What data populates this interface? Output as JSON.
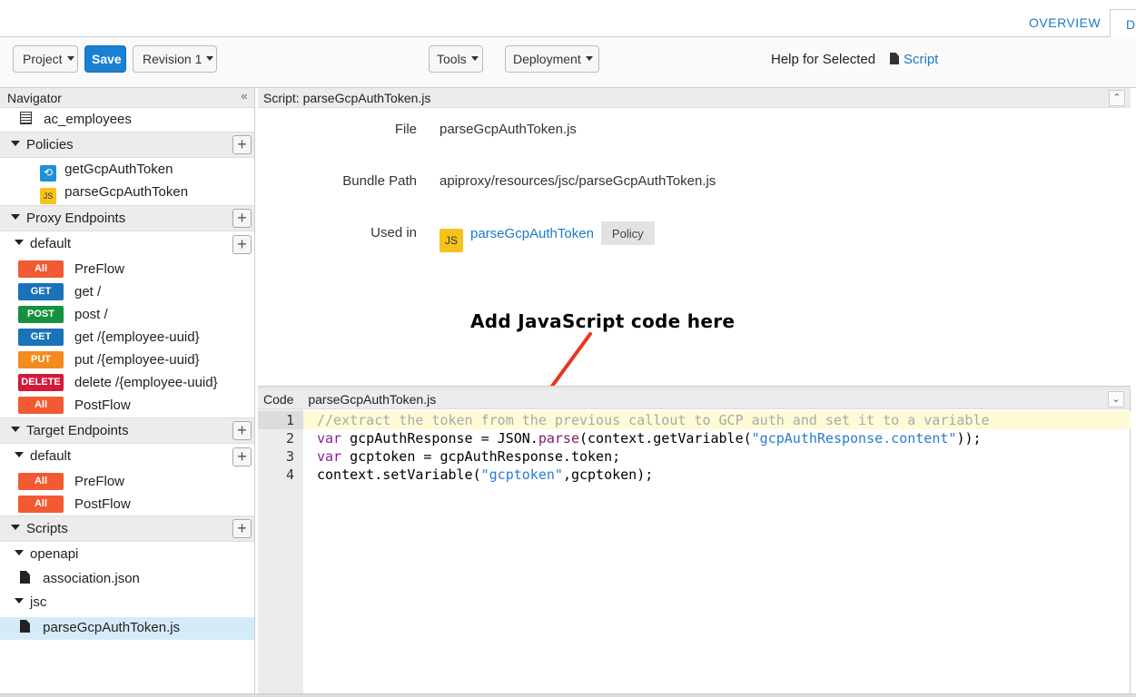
{
  "tabs": {
    "overview": "OVERVIEW",
    "develop": "D"
  },
  "toolbar": {
    "project": "Project",
    "save": "Save",
    "revision": "Revision 1",
    "tools": "Tools",
    "deployment": "Deployment",
    "help_label": "Help for Selected",
    "help_link": "Script"
  },
  "navigator": {
    "title": "Navigator",
    "collapse": "«",
    "top_item": "ac_employees",
    "policies": {
      "label": "Policies",
      "items": [
        {
          "icon": "callout-icon",
          "label": "getGcpAuthToken"
        },
        {
          "icon": "js-icon",
          "label": "parseGcpAuthToken"
        }
      ]
    },
    "proxy_endpoints": {
      "label": "Proxy Endpoints",
      "default_label": "default",
      "flows": [
        {
          "badge": "All",
          "label": "PreFlow"
        },
        {
          "badge": "GET",
          "label": "get /"
        },
        {
          "badge": "POST",
          "label": "post /"
        },
        {
          "badge": "GET",
          "label": "get /{employee-uuid}"
        },
        {
          "badge": "PUT",
          "label": "put /{employee-uuid}"
        },
        {
          "badge": "DELETE",
          "label": "delete /{employee-uuid}"
        },
        {
          "badge": "All",
          "label": "PostFlow"
        }
      ]
    },
    "target_endpoints": {
      "label": "Target Endpoints",
      "default_label": "default",
      "flows": [
        {
          "badge": "All",
          "label": "PreFlow"
        },
        {
          "badge": "All",
          "label": "PostFlow"
        }
      ]
    },
    "scripts": {
      "label": "Scripts",
      "folders": [
        {
          "label": "openapi",
          "files": [
            "association.json"
          ]
        },
        {
          "label": "jsc",
          "files": [
            "parseGcpAuthToken.js"
          ]
        }
      ]
    }
  },
  "detail": {
    "header": "Script: parseGcpAuthToken.js",
    "file_label": "File",
    "file_value": "parseGcpAuthToken.js",
    "bundle_label": "Bundle Path",
    "bundle_value": "apiproxy/resources/jsc/parseGcpAuthToken.js",
    "used_label": "Used in",
    "used_icon": "JS",
    "used_link": "parseGcpAuthToken",
    "used_tag": "Policy"
  },
  "annotation": "Add JavaScript code here",
  "code": {
    "header_label": "Code",
    "header_file": "parseGcpAuthToken.js",
    "line_numbers": [
      "1",
      "2",
      "3",
      "4"
    ],
    "lines": [
      [
        "//extract the token from the previous callout to GCP auth and set it to a variable"
      ],
      [
        "var",
        " gcpAuthResponse = JSON.",
        "parse",
        "(context.getVariable(",
        "\"gcpAuthResponse.content\"",
        "));"
      ],
      [
        "var",
        " gcptoken = gcpAuthResponse.token;"
      ],
      [
        "context.setVariable(",
        "\"gcptoken\"",
        ",gcptoken);"
      ]
    ]
  },
  "colors": {
    "accent": "#1d7ac6",
    "save": "#1a80d1",
    "arrow": "#e8361e"
  }
}
